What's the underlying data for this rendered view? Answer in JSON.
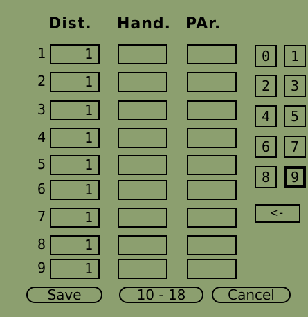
{
  "headers": {
    "distance": "Dist.",
    "handicap": "Hand.",
    "par": "PAr."
  },
  "rows": [
    {
      "num": "1",
      "dist": "1",
      "hand": "",
      "par": ""
    },
    {
      "num": "2",
      "dist": "1",
      "hand": "",
      "par": ""
    },
    {
      "num": "3",
      "dist": "1",
      "hand": "",
      "par": ""
    },
    {
      "num": "4",
      "dist": "1",
      "hand": "",
      "par": ""
    },
    {
      "num": "5",
      "dist": "1",
      "hand": "",
      "par": ""
    },
    {
      "num": "6",
      "dist": "1",
      "hand": "",
      "par": ""
    },
    {
      "num": "7",
      "dist": "1",
      "hand": "",
      "par": ""
    },
    {
      "num": "8",
      "dist": "1",
      "hand": "",
      "par": ""
    },
    {
      "num": "9",
      "dist": "1",
      "hand": "",
      "par": ""
    }
  ],
  "keypad": [
    "0",
    "1",
    "2",
    "3",
    "4",
    "5",
    "6",
    "7",
    "8",
    "9"
  ],
  "keypad_selected": "9",
  "backspace_label": "<-",
  "buttons": {
    "save": "Save",
    "range": "10 - 18",
    "cancel": "Cancel"
  },
  "colors": {
    "background": "#8c9f6f",
    "foreground": "#000000"
  }
}
